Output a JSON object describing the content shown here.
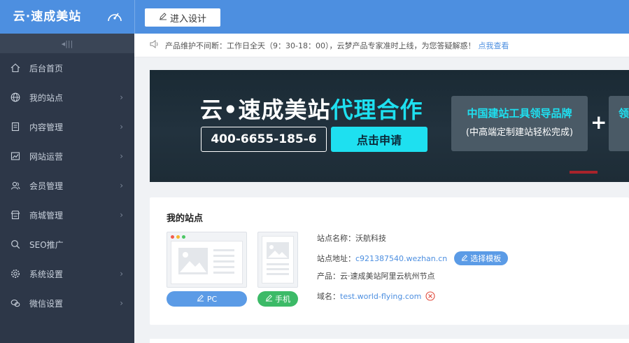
{
  "header": {
    "logo": "云·速成美站",
    "design_button": "进入设计",
    "gauge_icon": "speedometer-icon"
  },
  "sidebar": {
    "collapse_glyph": "◂|||",
    "items": [
      {
        "label": "后台首页",
        "icon": "home-icon",
        "has_arrow": false
      },
      {
        "label": "我的站点",
        "icon": "globe-icon",
        "has_arrow": true
      },
      {
        "label": "内容管理",
        "icon": "document-icon",
        "has_arrow": true
      },
      {
        "label": "网站运营",
        "icon": "chart-icon",
        "has_arrow": true
      },
      {
        "label": "会员管理",
        "icon": "users-icon",
        "has_arrow": true
      },
      {
        "label": "商城管理",
        "icon": "store-icon",
        "has_arrow": true
      },
      {
        "label": "SEO推广",
        "icon": "search-icon",
        "has_arrow": false
      },
      {
        "label": "系统设置",
        "icon": "gear-icon",
        "has_arrow": true
      },
      {
        "label": "微信设置",
        "icon": "wechat-icon",
        "has_arrow": true
      }
    ],
    "arrow_glyph": "›"
  },
  "notice": {
    "text": "产品维护不间断：工作日全天（9：30-18：00），云梦产品专家准时上线，为您答疑解惑！",
    "link": "点我查看"
  },
  "banner": {
    "title_main": "云•速成美站",
    "title_accent": "代理合作",
    "phone": "400-6655-185-6",
    "apply": "点击申请",
    "box1_line1": "中国建站工具领导品牌",
    "box1_line2": "(中高端定制建站轻松完成)",
    "plus": "+",
    "box2_text": "领"
  },
  "site": {
    "title": "我的站点",
    "pc_button": "PC",
    "mobile_button": "手机",
    "name_label": "站点名称：",
    "name_value": "沃航科技",
    "address_label": "站点地址：",
    "address_value": "c921387540.wezhan.cn",
    "template_button": "选择模板",
    "product_label": "产品：",
    "product_value": "云·速成美站阿里云杭州节点",
    "domain_label": "域名：",
    "domain_value": "test.world-flying.com"
  },
  "colors": {
    "topbar": "#4d8fe0",
    "sidebar": "#2d3748",
    "accent_cyan": "#1ee0f0",
    "pc_button": "#5b9be6",
    "mobile_button": "#3cba67",
    "delete_icon": "#e04a3c"
  }
}
